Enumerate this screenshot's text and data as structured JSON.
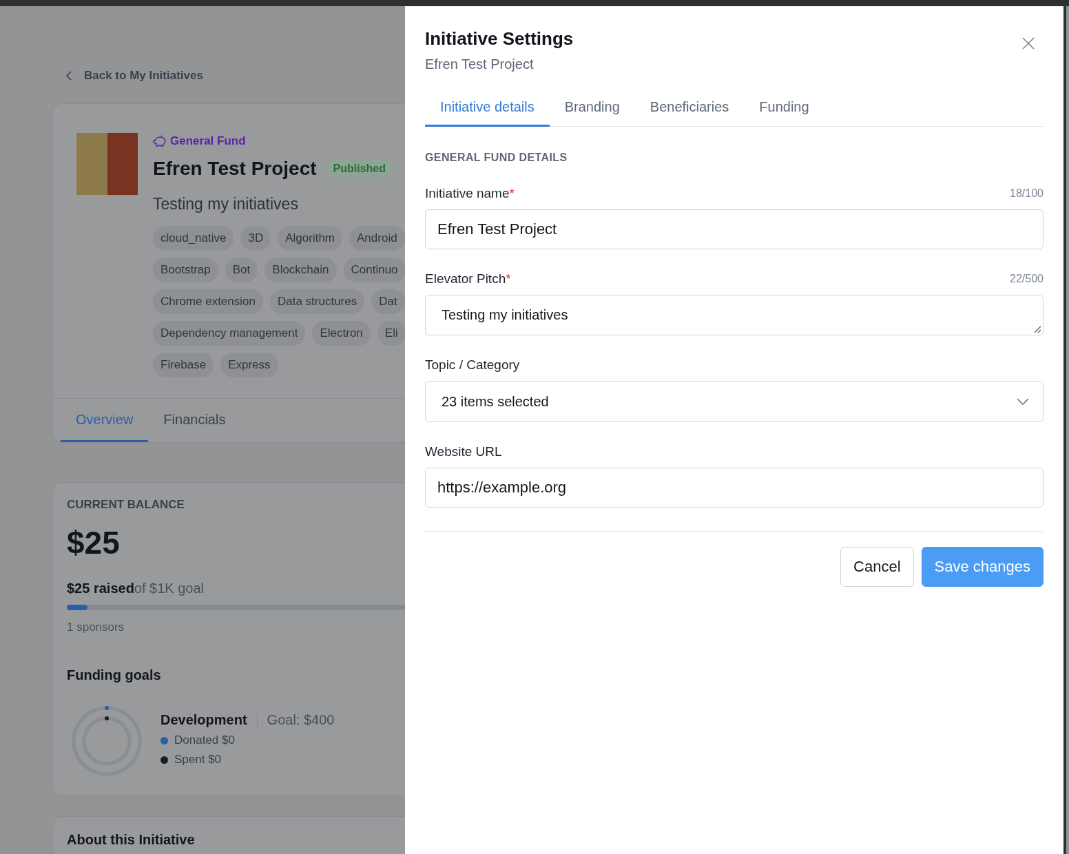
{
  "back_link": {
    "label": "Back to My Initiatives"
  },
  "initiative": {
    "fund_type": "General Fund",
    "title": "Efren Test Project",
    "status": "Published",
    "pitch": "Testing my initiatives",
    "tag_rows": [
      [
        "cloud_native",
        "3D",
        "Algorithm",
        "Android"
      ],
      [
        "Bootstrap",
        "Bot",
        "Blockchain",
        "Continuo"
      ],
      [
        "Chrome extension",
        "Data structures",
        "Dat"
      ],
      [
        "Dependency management",
        "Electron",
        "Eli"
      ],
      [
        "Firebase",
        "Express"
      ]
    ]
  },
  "page_tabs": [
    {
      "label": "Overview",
      "selected": true
    },
    {
      "label": "Financials",
      "selected": false
    }
  ],
  "balance": {
    "heading": "CURRENT BALANCE",
    "amount": "$25",
    "raised": "**$25 raised**of $1K goal",
    "level": 0.025,
    "sponsors": "1 sponsors"
  },
  "funding_goals": {
    "heading": "Funding goals",
    "goals": [
      {
        "name": "Development",
        "goal": "Goal: $400",
        "legend": [
          {
            "label": "Donated $0",
            "color": "#2a5fa8"
          },
          {
            "label": "Spent $0",
            "color": "#1a1d24"
          }
        ]
      }
    ]
  },
  "about": {
    "heading": "About this Initiative"
  },
  "drawer": {
    "title": "Initiative Settings",
    "subtitle": "Efren Test Project",
    "tabs": [
      {
        "label": "Initiative details",
        "selected": true
      },
      {
        "label": "Branding",
        "selected": false
      },
      {
        "label": "Beneficiaries",
        "selected": false
      },
      {
        "label": "Funding",
        "selected": false
      }
    ],
    "section": "GENERAL FUND DETAILS",
    "fields": [
      {
        "kind": "text",
        "label": "Initiative name",
        "required_mark": "*",
        "counter": "18/100",
        "value": "Efren Test Project"
      },
      {
        "kind": "textarea",
        "label": "Elevator Pitch",
        "required_mark": "*",
        "counter": "22/500",
        "value": "Testing my initiatives"
      },
      {
        "kind": "select",
        "label": "Topic / Category",
        "value": "23 items selected"
      },
      {
        "kind": "text",
        "label": "Website URL",
        "value": "https://example.org"
      }
    ],
    "buttons": [
      {
        "label": "Cancel",
        "kind": "secondary"
      },
      {
        "label": "Save changes",
        "kind": "primary"
      }
    ]
  }
}
